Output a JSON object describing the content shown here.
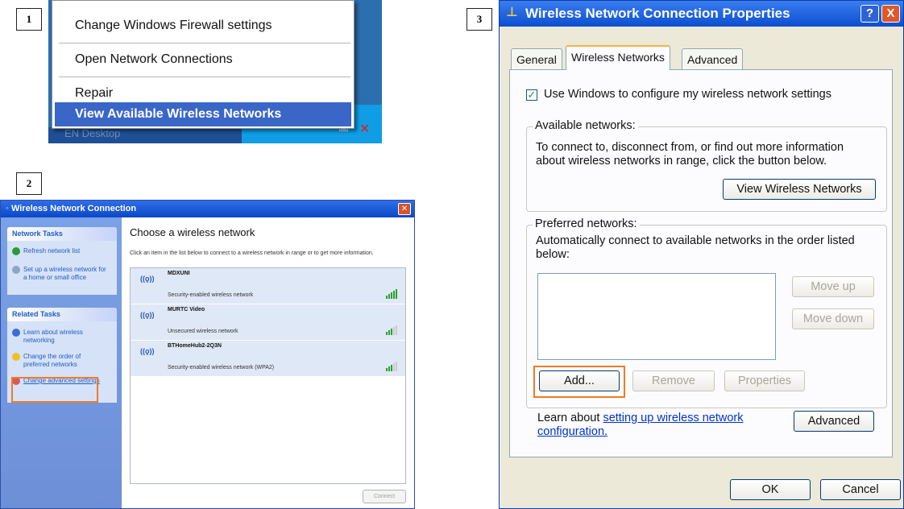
{
  "steps": [
    "1",
    "2",
    "3"
  ],
  "panel1": {
    "menu": [
      "Change Windows Firewall settings",
      "Open Network Connections",
      "Repair",
      "View Available Wireless Networks"
    ],
    "taskbar_text": "EN  Desktop"
  },
  "panel2": {
    "title": "Wireless Network Connection",
    "network_tasks_header": "Network Tasks",
    "network_tasks": [
      "Refresh network list",
      "Set up a wireless network for a home or small office"
    ],
    "related_tasks_header": "Related Tasks",
    "related_tasks": [
      "Learn about wireless networking",
      "Change the order of preferred networks",
      "Change advanced settings"
    ],
    "heading": "Choose a wireless network",
    "instructions": "Click an item in the list below to connect to a wireless network in range or to get more information.",
    "networks": [
      {
        "name": "MDXUNI",
        "desc": "Security-enabled wireless network"
      },
      {
        "name": "MURTC Video",
        "desc": "Unsecured wireless network"
      },
      {
        "name": "BTHomeHub2-2Q3N",
        "desc": "Security-enabled wireless network (WPA2)"
      }
    ],
    "connect_label": "Connect"
  },
  "panel3": {
    "title": "Wireless Network Connection Properties",
    "help_btn": "?",
    "close_btn": "X",
    "tabs": [
      "General",
      "Wireless Networks",
      "Advanced"
    ],
    "use_windows_label": "Use Windows to configure my wireless network settings",
    "available_legend": "Available networks:",
    "available_text": "To connect to, disconnect from, or find out more information about wireless networks in range, click the button below.",
    "view_networks_btn": "View Wireless Networks",
    "preferred_legend": "Preferred networks:",
    "preferred_text": "Automatically connect to available networks in the order listed below:",
    "move_up": "Move up",
    "move_down": "Move down",
    "add": "Add...",
    "remove": "Remove",
    "properties": "Properties",
    "learn_prefix": "Learn about ",
    "learn_link": "setting up wireless network configuration.",
    "advanced_btn": "Advanced",
    "ok": "OK",
    "cancel": "Cancel"
  },
  "colors": {
    "highlight": "#f07b22",
    "xp_blue": "#0c4fcf"
  }
}
